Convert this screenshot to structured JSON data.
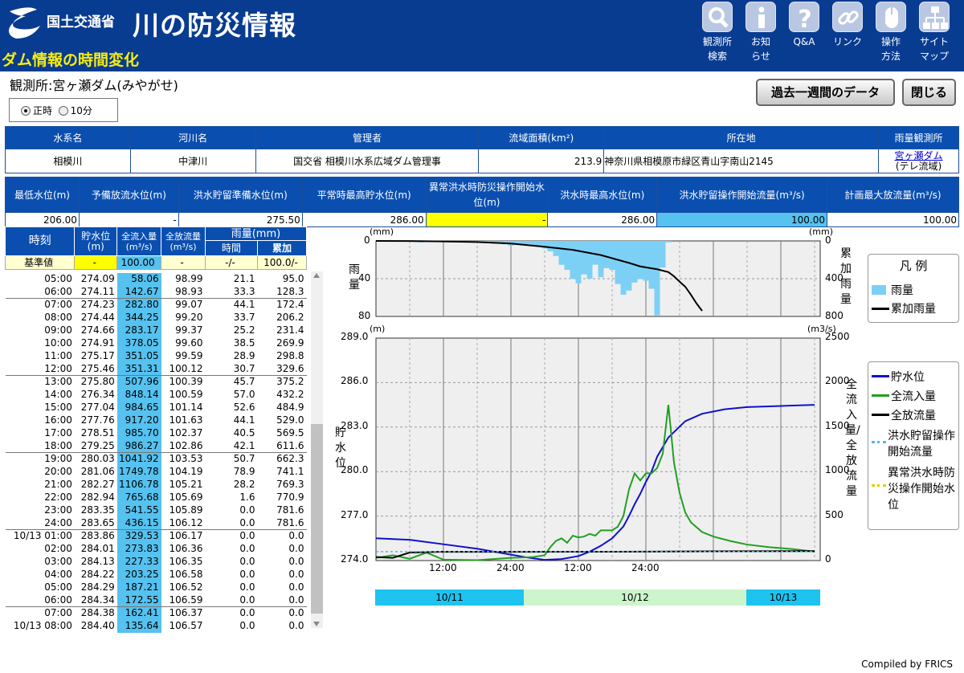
{
  "header": {
    "ministry": "国土交通省",
    "site_title": "川の防災情報",
    "page_heading": "ダム情報の時間変化"
  },
  "nav": [
    {
      "label": "観測所\n検索",
      "icon": "search-icon"
    },
    {
      "label": "お知\nらせ",
      "icon": "info-icon"
    },
    {
      "label": "Q&A",
      "icon": "question-icon"
    },
    {
      "label": "リンク",
      "icon": "link-icon"
    },
    {
      "label": "操作\n方法",
      "icon": "mouse-icon"
    },
    {
      "label": "サイト\nマップ",
      "icon": "sitemap-icon"
    }
  ],
  "station": "観測所:宮ヶ瀬ダム(みやがせ)",
  "radio": {
    "hourly": "正時",
    "ten_min": "10分"
  },
  "buttons": {
    "past_week": "過去一週間のデータ",
    "close": "閉じる"
  },
  "info1": {
    "headers": [
      "水系名",
      "河川名",
      "管理者",
      "流域面積(km²)",
      "所在地",
      "雨量観測所"
    ],
    "values": [
      "相模川",
      "中津川",
      "国交省 相模川水系広域ダム管理事",
      "213.9",
      "神奈川県相模原市緑区青山字南山2145"
    ],
    "rain_station_link": "宮ヶ瀬ダム",
    "rain_station_note": "(テレ流域)"
  },
  "info2": {
    "headers": [
      "最低水位(m)",
      "予備放流水位(m)",
      "洪水貯留準備水位(m)",
      "平常時最高貯水位(m)",
      "異常洪水時防災操作開始水位(m)",
      "洪水時最高水位(m)",
      "洪水貯留操作開始流量(m³/s)",
      "計画最大放流量(m³/s)"
    ],
    "values": [
      "206.00",
      "-",
      "275.50",
      "286.00",
      "-",
      "286.00",
      "100.00",
      "100.00"
    ]
  },
  "table": {
    "h_time": "時刻",
    "h_level": "貯水位\n(m)",
    "h_inflow": "全流入量\n(m³/s)",
    "h_outflow": "全放流量\n(m³/s)",
    "h_rain": "雨量(mm)",
    "h_rain_hour": "時間",
    "h_rain_cum": "累加",
    "base": [
      "基準値",
      "-",
      "100.00",
      "-",
      "-/-",
      "100.0/-"
    ],
    "rows": [
      [
        "05:00",
        "274.09",
        "58.06",
        "98.99",
        "21.1",
        "95.0"
      ],
      [
        "06:00",
        "274.11",
        "142.67",
        "98.93",
        "33.3",
        "128.3"
      ],
      [
        "07:00",
        "274.23",
        "282.80",
        "99.07",
        "44.1",
        "172.4"
      ],
      [
        "08:00",
        "274.44",
        "344.25",
        "99.20",
        "33.7",
        "206.2"
      ],
      [
        "09:00",
        "274.66",
        "283.17",
        "99.37",
        "25.2",
        "231.4"
      ],
      [
        "10:00",
        "274.91",
        "378.05",
        "99.60",
        "38.5",
        "269.9"
      ],
      [
        "11:00",
        "275.17",
        "351.05",
        "99.59",
        "28.9",
        "298.8"
      ],
      [
        "12:00",
        "275.46",
        "351.31",
        "100.12",
        "30.7",
        "329.6"
      ],
      [
        "13:00",
        "275.80",
        "507.96",
        "100.39",
        "45.7",
        "375.2"
      ],
      [
        "14:00",
        "276.34",
        "848.14",
        "100.59",
        "57.0",
        "432.2"
      ],
      [
        "15:00",
        "277.04",
        "984.65",
        "101.14",
        "52.6",
        "484.9"
      ],
      [
        "16:00",
        "277.76",
        "917.20",
        "101.63",
        "44.1",
        "529.0"
      ],
      [
        "17:00",
        "278.51",
        "985.70",
        "102.37",
        "40.5",
        "569.5"
      ],
      [
        "18:00",
        "279.25",
        "986.27",
        "102.86",
        "42.1",
        "611.6"
      ],
      [
        "19:00",
        "280.03",
        "1041.92",
        "103.53",
        "50.7",
        "662.3"
      ],
      [
        "20:00",
        "281.06",
        "1749.78",
        "104.19",
        "78.9",
        "741.1"
      ],
      [
        "21:00",
        "282.27",
        "1106.78",
        "105.21",
        "28.2",
        "769.3"
      ],
      [
        "22:00",
        "282.94",
        "765.68",
        "105.69",
        "1.6",
        "770.9"
      ],
      [
        "23:00",
        "283.35",
        "541.55",
        "105.89",
        "0.0",
        "781.6"
      ],
      [
        "24:00",
        "283.65",
        "436.15",
        "106.12",
        "0.0",
        "781.6"
      ],
      [
        "10/13 01:00",
        "283.86",
        "329.53",
        "106.17",
        "0.0",
        "0.0"
      ],
      [
        "02:00",
        "284.01",
        "273.83",
        "106.36",
        "0.0",
        "0.0"
      ],
      [
        "03:00",
        "284.13",
        "227.33",
        "106.35",
        "0.0",
        "0.0"
      ],
      [
        "04:00",
        "284.22",
        "203.25",
        "106.58",
        "0.0",
        "0.0"
      ],
      [
        "05:00",
        "284.29",
        "187.21",
        "106.52",
        "0.0",
        "0.0"
      ],
      [
        "06:00",
        "284.34",
        "172.55",
        "106.59",
        "0.0",
        "0.0"
      ],
      [
        "07:00",
        "284.38",
        "162.41",
        "106.37",
        "0.0",
        "0.0"
      ],
      [
        "10/13 08:00",
        "284.40",
        "135.64",
        "106.57",
        "0.0",
        "0.0"
      ]
    ]
  },
  "chart_data": [
    {
      "type": "bar",
      "title": "",
      "ylabel": "雨量",
      "y2label": "累加雨量",
      "yunit": "(mm)",
      "y2unit": "(mm)",
      "ylim": [
        0,
        80
      ],
      "y2lim": [
        0,
        800
      ],
      "yticks": [
        "0",
        "40",
        "80"
      ],
      "y2ticks": [
        "0",
        "400",
        "800"
      ],
      "grid": true,
      "legend_title": "凡 例",
      "series": [
        {
          "name": "雨量",
          "color": "#7dd0f5",
          "x_hours": [
            4,
            5,
            6,
            7,
            8,
            9,
            10,
            11,
            12,
            13,
            14,
            15,
            16,
            17,
            18,
            19,
            20,
            21,
            22,
            23,
            24,
            25,
            26,
            27,
            28,
            29,
            30,
            31,
            32,
            33,
            34,
            35,
            36,
            37,
            38,
            39,
            40,
            41,
            42,
            43,
            44,
            45,
            46,
            47,
            48,
            49,
            50,
            51,
            52
          ],
          "values": [
            0.5,
            0.6,
            0.5,
            1.2,
            1.6,
            1.0,
            1.2,
            0.7,
            1.3,
            1.4,
            1.0,
            1.1,
            1.5,
            1.6,
            1.2,
            1.9,
            1.0,
            1.9,
            2.0,
            3.6,
            4.9,
            4.2,
            4.6,
            3.4,
            5.4,
            5.5,
            8.0,
            10.9,
            16.0,
            25.3,
            30.6,
            40.2,
            45.0,
            35.5,
            40.0,
            25.2,
            38.5,
            28.9,
            30.7,
            45.7,
            57.0,
            52.6,
            44.1,
            40.5,
            42.1,
            50.7,
            78.9,
            28.2,
            1.6
          ]
        },
        {
          "name": "累加雨量",
          "color": "#000000",
          "x_hours": [
            0,
            6,
            12,
            18,
            24,
            30,
            35,
            40,
            45,
            47,
            50,
            52,
            53,
            54,
            55,
            56,
            57,
            58
          ],
          "values": [
            0,
            1,
            5,
            12,
            28,
            62,
            95,
            150,
            233,
            270,
            300,
            330,
            375,
            432,
            485,
            570,
            662,
            741,
            770,
            782,
            782
          ]
        }
      ]
    },
    {
      "type": "line",
      "title": "",
      "ylabel": "貯水位",
      "y2label": "全流入量/全放流量",
      "yunit": "(m)",
      "y2unit": "(m3/s)",
      "ylim": [
        274,
        289
      ],
      "y2lim": [
        0,
        2500
      ],
      "yticks": [
        "274.0",
        "277.0",
        "280.0",
        "283.0",
        "286.0",
        "289.0"
      ],
      "y2ticks": [
        "0",
        "500",
        "1000",
        "1500",
        "2000",
        "2500"
      ],
      "xticks": [
        "12:00",
        "24:00",
        "12:00",
        "24:00"
      ],
      "date_bands": [
        "10/11",
        "10/12",
        "10/13"
      ],
      "grid": true,
      "series": [
        {
          "name": "貯水位",
          "color": "#1010d0",
          "axis": "left",
          "x_hours": [
            0,
            6,
            12,
            18,
            24,
            27,
            30,
            33,
            36,
            38,
            40,
            42,
            44,
            45,
            46,
            47,
            48,
            49,
            50,
            52,
            55,
            58,
            62,
            66,
            70,
            74,
            78
          ],
          "values": [
            275.5,
            275.4,
            275.1,
            274.8,
            274.4,
            274.2,
            274.05,
            274.1,
            274.3,
            274.6,
            275.0,
            275.5,
            276.3,
            277.0,
            277.8,
            278.5,
            279.3,
            280.0,
            281.0,
            282.3,
            283.4,
            283.9,
            284.2,
            284.35,
            284.4,
            284.45,
            284.5
          ]
        },
        {
          "name": "全流入量",
          "color": "#20a020",
          "axis": "right",
          "x_hours": [
            0,
            3,
            6,
            9,
            12,
            18,
            24,
            28,
            30,
            31,
            32,
            33,
            34,
            35,
            36,
            37,
            38,
            39,
            40,
            41,
            42,
            43,
            44,
            45,
            46,
            47,
            48,
            49,
            50,
            51,
            52,
            53,
            54,
            55,
            56,
            58,
            60,
            63,
            66,
            70,
            74,
            78
          ],
          "values": [
            30,
            60,
            20,
            90,
            10,
            5,
            30,
            40,
            60,
            150,
            220,
            250,
            200,
            280,
            260,
            270,
            300,
            280,
            340,
            340,
            340,
            380,
            500,
            800,
            980,
            900,
            980,
            980,
            1040,
            1200,
            1750,
            1100,
            760,
            540,
            430,
            320,
            270,
            220,
            180,
            150,
            130,
            100
          ]
        },
        {
          "name": "全放流量",
          "color": "#000000",
          "axis": "right",
          "x_hours": [
            0,
            3,
            6,
            12,
            24,
            36,
            48,
            60,
            78
          ],
          "values": [
            40,
            30,
            90,
            99,
            98,
            99,
            100,
            104,
            106
          ]
        },
        {
          "name": "洪水貯留操作開始流量",
          "color": "#55b5f0",
          "axis": "right",
          "dashed": true,
          "x_hours": [
            0,
            78
          ],
          "values": [
            100,
            100
          ]
        },
        {
          "name": "異常洪水時防災操作開始水位",
          "color": "#e0d000",
          "axis": "left",
          "dashed": true,
          "x_hours": [],
          "values": []
        }
      ]
    }
  ],
  "footer": "Compiled by FRICS"
}
